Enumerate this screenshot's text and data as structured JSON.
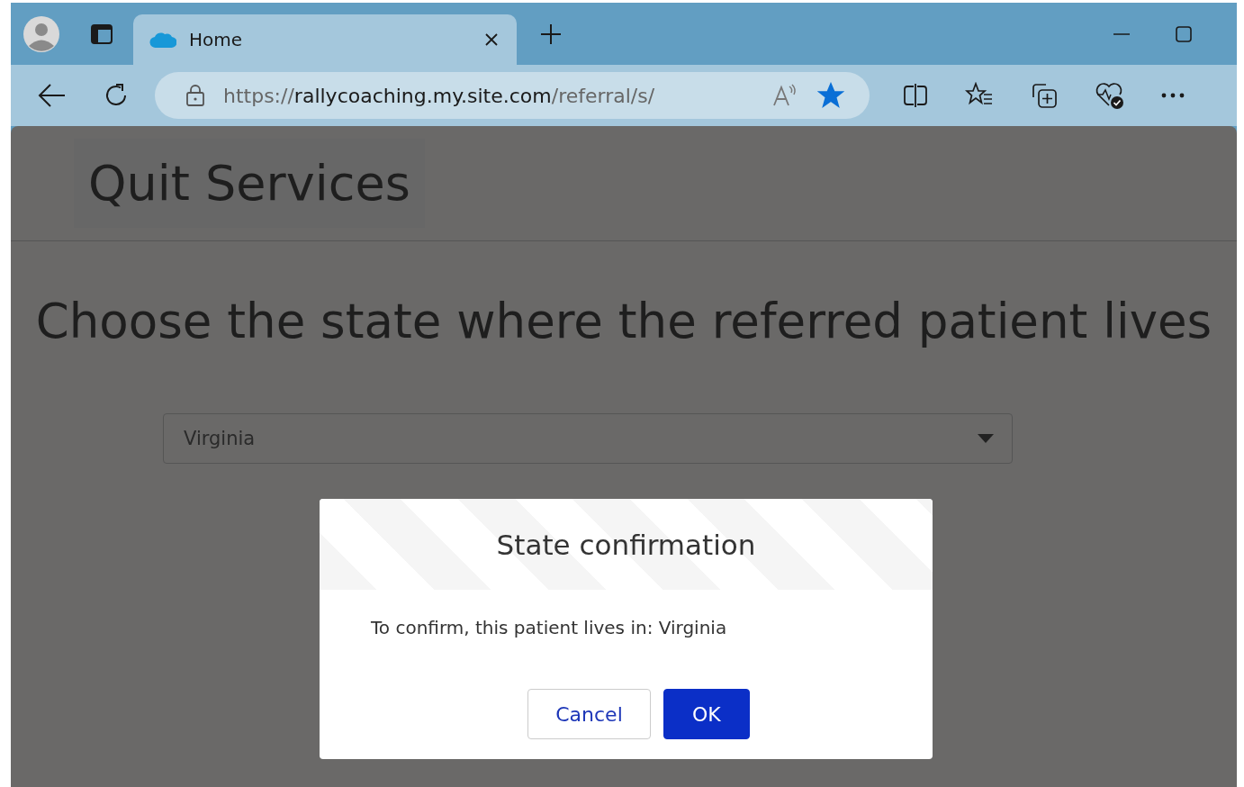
{
  "browser": {
    "tab": {
      "title": "Home",
      "selected": true
    },
    "address": {
      "prefix": "https://",
      "host": "rallycoaching.my.site.com",
      "path": "/referral/s/"
    },
    "favorited": true
  },
  "site": {
    "title": "Quit Services"
  },
  "page": {
    "heading": "Choose the state where the referred patient lives",
    "state_select": {
      "value": "Virginia"
    }
  },
  "dialog": {
    "title": "State confirmation",
    "message": "To confirm, this patient lives in: Virginia",
    "buttons": [
      {
        "label": "Cancel",
        "kind": "secondary"
      },
      {
        "label": "OK",
        "kind": "primary"
      }
    ]
  }
}
